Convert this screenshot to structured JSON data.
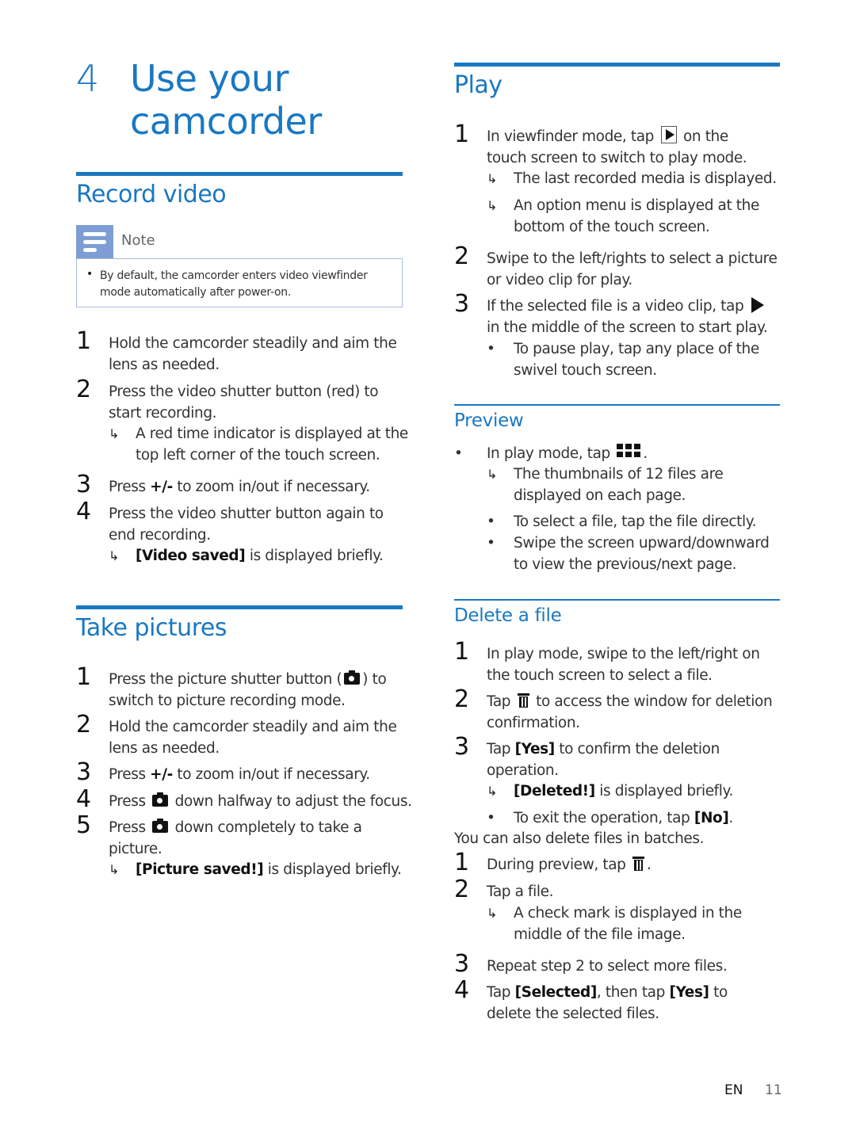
{
  "chapter": {
    "number": "4",
    "title": "Use your camcorder"
  },
  "record_video": {
    "heading": "Record video",
    "note": {
      "label": "Note",
      "icon": "note-icon",
      "bullet": "By default, the camcorder enters video viewfinder mode automatically after power-on."
    },
    "steps": [
      {
        "n": "1",
        "text": "Hold the camcorder steadily and aim the lens as needed."
      },
      {
        "n": "2",
        "text": "Press the video shutter button (red) to start recording.",
        "result": "A red time indicator is displayed at the top left corner of the touch screen."
      },
      {
        "n": "3",
        "pre": "Press ",
        "bold": "+/-",
        "post": " to zoom in/out if necessary."
      },
      {
        "n": "4",
        "text": "Press the video shutter button again to end recording.",
        "result_bold": "[Video saved]",
        "result_post": " is displayed briefly."
      }
    ]
  },
  "take_pictures": {
    "heading": "Take pictures",
    "steps": [
      {
        "n": "1",
        "pre": "Press the picture shutter button (",
        "icon": "camera-icon",
        "post": ") to switch to picture recording mode."
      },
      {
        "n": "2",
        "text": "Hold the camcorder steadily and aim the lens as needed."
      },
      {
        "n": "3",
        "pre": "Press ",
        "bold": "+/-",
        "post": " to zoom in/out if necessary."
      },
      {
        "n": "4",
        "pre": "Press ",
        "icon": "camera-icon",
        "post": " down halfway to adjust the focus."
      },
      {
        "n": "5",
        "pre": "Press ",
        "icon": "camera-icon",
        "post": " down completely to take a picture.",
        "result_bold": "[Picture saved!]",
        "result_post": " is displayed briefly."
      }
    ]
  },
  "play": {
    "heading": "Play",
    "steps": [
      {
        "n": "1",
        "pre": "In viewfinder mode, tap ",
        "icon": "play-box-icon",
        "post": " on the touch screen to switch to play mode.",
        "results": [
          "The last recorded media is displayed.",
          "An option menu is displayed at the bottom of the touch screen."
        ]
      },
      {
        "n": "2",
        "text": "Swipe to the left/rights to select a picture or video clip for play."
      },
      {
        "n": "3",
        "pre": "If the selected file is a video clip, tap ",
        "icon": "play-icon",
        "post": " in the middle of the screen to start play.",
        "bullet": "To pause play, tap any place of the swivel touch screen."
      }
    ]
  },
  "preview": {
    "heading": "Preview",
    "bullet_pre": "In play mode, tap ",
    "bullet_icon": "grid-icon",
    "bullet_post": ".",
    "result": "The thumbnails of 12 files are displayed on each page.",
    "sub_bullets": [
      "To select a file, tap the file directly.",
      "Swipe the screen upward/downward to view the previous/next page."
    ]
  },
  "delete_file": {
    "heading": "Delete a file",
    "steps": [
      {
        "n": "1",
        "text": "In play mode, swipe to the left/right on the touch screen to select a file."
      },
      {
        "n": "2",
        "pre": "Tap ",
        "icon": "trash-icon",
        "post": " to access the window for deletion confirmation."
      },
      {
        "n": "3",
        "pre": "Tap ",
        "bold": "[Yes]",
        "post": " to confirm the deletion operation.",
        "result_bold": "[Deleted!]",
        "result_post": " is displayed briefly.",
        "bullet_pre": "To exit the operation, tap ",
        "bullet_bold": "[No]",
        "bullet_post": "."
      }
    ],
    "batch_intro": "You can also delete files in batches.",
    "batch_steps": [
      {
        "n": "1",
        "pre": "During preview, tap ",
        "icon": "trash-icon",
        "post": "."
      },
      {
        "n": "2",
        "text": "Tap a file.",
        "result": "A check mark is displayed in the middle of the file image."
      },
      {
        "n": "3",
        "text": "Repeat step 2 to select more files."
      },
      {
        "n": "4",
        "pre": "Tap ",
        "bold": "[Selected]",
        "mid": ", then tap ",
        "bold2": "[Yes]",
        "post": " to delete the selected files."
      }
    ]
  },
  "footer": {
    "lang": "EN",
    "page": "11"
  },
  "colors": {
    "accent": "#1a78c2",
    "note_icon_bg": "#7d9dd4",
    "note_border": "#a9bce0"
  }
}
